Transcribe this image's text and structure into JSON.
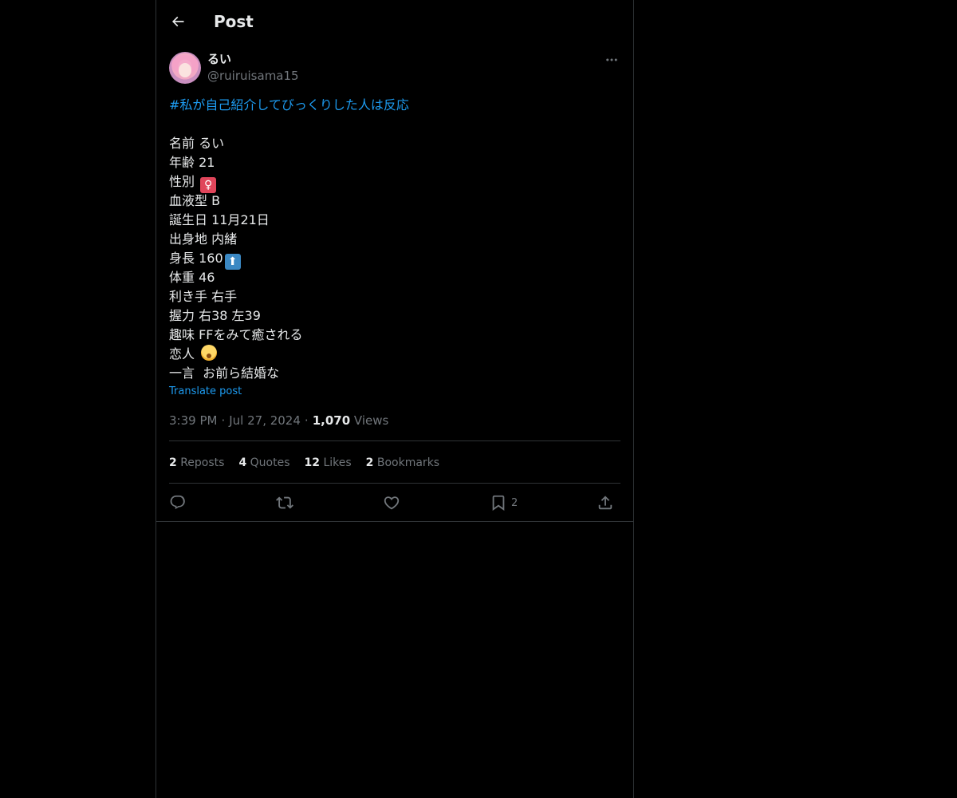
{
  "header": {
    "title": "Post",
    "back_icon": "arrow-left-icon"
  },
  "author": {
    "display_name": "るい",
    "handle": "@ruiruisama15"
  },
  "post": {
    "hashtag": "#私が自己紹介してびっくりした人は反応",
    "lines": [
      "名前 るい",
      "年齢 21",
      "性別",
      "血液型 B",
      "誕生日 11月21日",
      "出身地 内緒",
      "身長 160",
      "体重 46",
      "利き手 右手",
      "握力 右38 左39",
      "趣味 FFをみて癒される",
      "恋人",
      "一言  お前ら結婚な"
    ],
    "emoji": {
      "female_sign": "♀",
      "up_arrow": "⬆",
      "face": "hushed-face-emoji"
    },
    "translate_label": "Translate post"
  },
  "meta": {
    "time": "3:39 PM",
    "separator": "·",
    "date": "Jul 27, 2024",
    "views_count": "1,070",
    "views_label": "Views"
  },
  "stats": {
    "reposts_count": "2",
    "reposts_label": "Reposts",
    "quotes_count": "4",
    "quotes_label": "Quotes",
    "likes_count": "12",
    "likes_label": "Likes",
    "bookmarks_count": "2",
    "bookmarks_label": "Bookmarks"
  },
  "actions": {
    "bookmark_count": "2"
  },
  "colors": {
    "background": "#000000",
    "text": "#e7e9ea",
    "muted": "#71767b",
    "accent": "#1d9bf0",
    "border": "#2f3336"
  }
}
